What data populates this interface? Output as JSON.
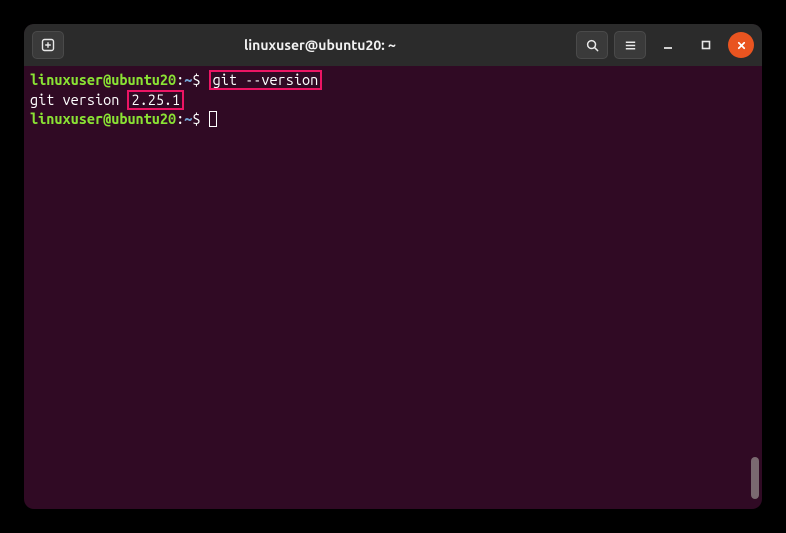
{
  "titlebar": {
    "title": "linuxuser@ubuntu20: ~"
  },
  "prompt": {
    "user_host": "linuxuser@ubuntu20",
    "separator1": ":",
    "path": "~",
    "separator2": "$"
  },
  "lines": {
    "cmd1": "git --version",
    "output_prefix": "git version ",
    "output_version": "2.25.1"
  }
}
